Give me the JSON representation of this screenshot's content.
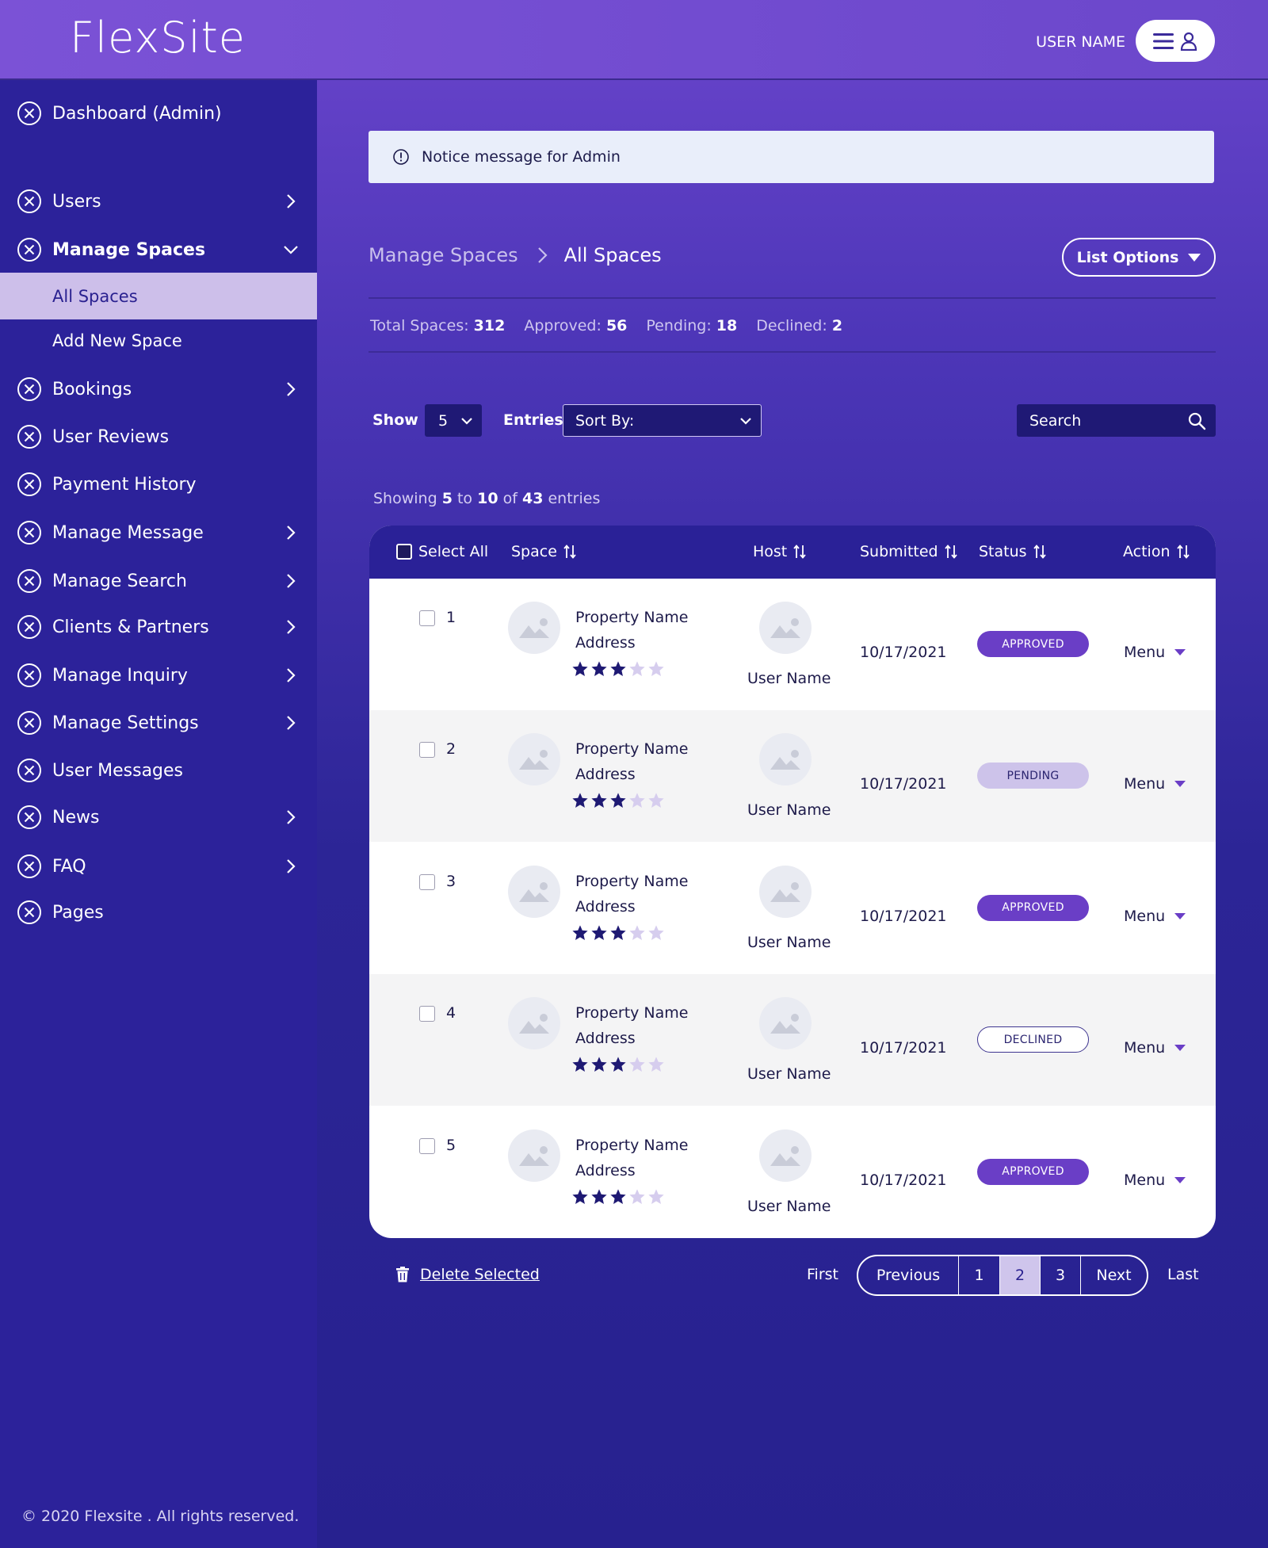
{
  "header": {
    "logo": "FlexSite",
    "user_name": "USER NAME",
    "user_menu_icons": [
      "hamburger-icon",
      "user-icon"
    ]
  },
  "sidebar": {
    "items": [
      {
        "label": "Dashboard (Admin)",
        "icon": "close-circle-icon",
        "chevron": null
      },
      {
        "label": "Users",
        "icon": "close-circle-icon",
        "chevron": "right"
      },
      {
        "label": "Manage Spaces",
        "icon": "close-circle-icon",
        "chevron": "down",
        "expanded": true
      },
      {
        "label": "Bookings",
        "icon": "close-circle-icon",
        "chevron": "right"
      },
      {
        "label": "User Reviews",
        "icon": "close-circle-icon",
        "chevron": null
      },
      {
        "label": "Payment History",
        "icon": "close-circle-icon",
        "chevron": null
      },
      {
        "label": "Manage Message",
        "icon": "close-circle-icon",
        "chevron": "right"
      },
      {
        "label": "Manage Search",
        "icon": "close-circle-icon",
        "chevron": "right"
      },
      {
        "label": "Clients & Partners",
        "icon": "close-circle-icon",
        "chevron": "right"
      },
      {
        "label": "Manage Inquiry",
        "icon": "close-circle-icon",
        "chevron": "right"
      },
      {
        "label": "Manage Settings",
        "icon": "close-circle-icon",
        "chevron": "right"
      },
      {
        "label": "User Messages",
        "icon": "close-circle-icon",
        "chevron": null
      },
      {
        "label": "News",
        "icon": "close-circle-icon",
        "chevron": "right"
      },
      {
        "label": "FAQ",
        "icon": "close-circle-icon",
        "chevron": "right"
      },
      {
        "label": "Pages",
        "icon": "close-circle-icon",
        "chevron": null
      }
    ],
    "sub_items": [
      {
        "label": "All Spaces",
        "active": true
      },
      {
        "label": "Add New Space",
        "active": false
      }
    ]
  },
  "notice": {
    "text": "Notice message for Admin",
    "icon": "info-icon"
  },
  "breadcrumb": {
    "parent": "Manage Spaces",
    "current": "All Spaces"
  },
  "list_options_label": "List Options",
  "stats": {
    "total_label": "Total Spaces:",
    "total": "312",
    "approved_label": "Approved:",
    "approved": "56",
    "pending_label": "Pending:",
    "pending": "18",
    "declined_label": "Declined:",
    "declined": "2"
  },
  "controls": {
    "show_label": "Show",
    "show_value": "5",
    "entries_label": "Entries",
    "sort_value": "Sort By:",
    "search_placeholder": "Search"
  },
  "showing": {
    "prefix": "Showing",
    "from": "5",
    "to_word": "to",
    "to": "10",
    "of_word": "of",
    "total": "43",
    "suffix": "entries"
  },
  "table": {
    "headers": {
      "select_all": "Select All",
      "space": "Space",
      "host": "Host",
      "submitted": "Submitted",
      "status": "Status",
      "action": "Action"
    },
    "rows": [
      {
        "num": "1",
        "property": "Property Name",
        "address": "Address",
        "rating": 3,
        "rating_max": 5,
        "host": "User Name",
        "date": "10/17/2021",
        "status": "APPROVED",
        "status_type": "approved",
        "action": "Menu"
      },
      {
        "num": "2",
        "property": "Property Name",
        "address": "Address",
        "rating": 3,
        "rating_max": 5,
        "host": "User Name",
        "date": "10/17/2021",
        "status": "PENDING",
        "status_type": "pending",
        "action": "Menu"
      },
      {
        "num": "3",
        "property": "Property Name",
        "address": "Address",
        "rating": 3,
        "rating_max": 5,
        "host": "User Name",
        "date": "10/17/2021",
        "status": "APPROVED",
        "status_type": "approved",
        "action": "Menu"
      },
      {
        "num": "4",
        "property": "Property Name",
        "address": "Address",
        "rating": 3,
        "rating_max": 5,
        "host": "User Name",
        "date": "10/17/2021",
        "status": "DECLINED",
        "status_type": "declined",
        "action": "Menu"
      },
      {
        "num": "5",
        "property": "Property Name",
        "address": "Address",
        "rating": 3,
        "rating_max": 5,
        "host": "User Name",
        "date": "10/17/2021",
        "status": "APPROVED",
        "status_type": "approved",
        "action": "Menu"
      }
    ]
  },
  "delete_selected": "Delete Selected",
  "pagination": {
    "first": "First",
    "previous": "Previous",
    "pages": [
      "1",
      "2",
      "3"
    ],
    "current": "2",
    "next": "Next",
    "last": "Last"
  },
  "footer": "© 2020 Flexsite . All rights reserved.",
  "colors": {
    "sidebar_bg": "#2c229a",
    "table_header": "#2a2197",
    "approved": "#6a3ec6",
    "pending": "#cdc3ea",
    "star_filled": "#1e1973",
    "star_empty": "#d6cdee"
  }
}
